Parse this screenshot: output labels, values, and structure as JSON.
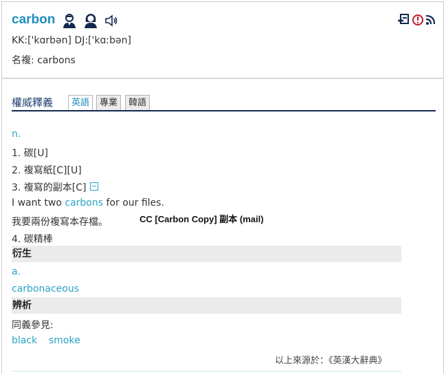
{
  "header": {
    "word": "carbon",
    "pronunciation": "KK:['kɑrbən] DJ:['kɑːbən]",
    "plural": "名複: carbons",
    "icons": [
      "male-voice-icon",
      "female-voice-icon",
      "speaker-icon"
    ],
    "tools": [
      "add-to-vocab-icon",
      "report-icon",
      "rss-icon"
    ]
  },
  "tabs": {
    "section_label": "權威釋義",
    "items": [
      "英語",
      "專業",
      "韓語"
    ],
    "active": "英語"
  },
  "definitions": {
    "pos_noun": "n.",
    "d1": "1. 碳[U]",
    "d2": "2. 複寫紙[C][U]",
    "d3": "3. 複寫的副本[C]",
    "example_pre": "I want two ",
    "example_word": "carbons",
    "example_post": " for our files.",
    "example_zh": "我要兩份複寫本存檔。",
    "cc_note": "CC [Carbon Copy] 副本 (mail)",
    "d4": "4. 碳精棒"
  },
  "derivatives": {
    "heading": "衍生",
    "pos": "a.",
    "word": "carbonaceous"
  },
  "analysis": {
    "heading": "辨析",
    "label": "同義參見:",
    "links": [
      "black",
      "smoke"
    ]
  },
  "footer": {
    "source": "以上來源於：《英漢大辭典》"
  },
  "colors": {
    "accent": "#1e8fbd",
    "link": "#2aa2c6",
    "navy": "#13284f",
    "band": "#ebebeb"
  }
}
